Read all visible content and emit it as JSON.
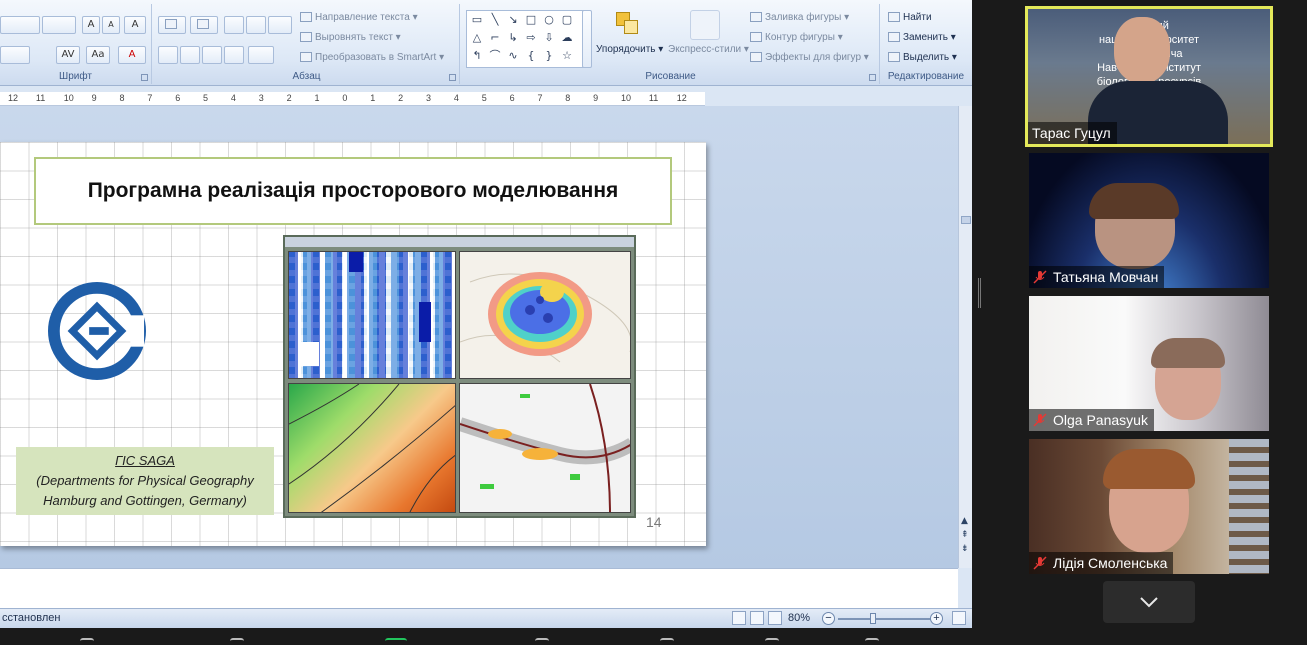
{
  "ribbon": {
    "font_group": {
      "label": "Шрифт",
      "grow_font": "A",
      "shrink_font": "A",
      "clear_format": "A",
      "spacing": "AV",
      "case": "Aa",
      "font_color": "A"
    },
    "paragraph_group": {
      "label": "Абзац",
      "text_direction": "Направление текста",
      "align_text": "Выровнять текст",
      "convert_smartart": "Преобразовать в SmartArt"
    },
    "drawing_group": {
      "label": "Рисование",
      "arrange": "Упорядочить",
      "quick_styles": "Экспресс-стили",
      "shape_fill": "Заливка фигуры",
      "shape_outline": "Контур фигуры",
      "shape_effects": "Эффекты для фигур"
    },
    "editing_group": {
      "label": "Редактирование",
      "find": "Найти",
      "replace": "Заменить",
      "select": "Выделить"
    }
  },
  "ruler": {
    "ticks": [
      "12",
      "11",
      "10",
      "9",
      "8",
      "7",
      "6",
      "5",
      "4",
      "3",
      "2",
      "1",
      "0",
      "1",
      "2",
      "3",
      "4",
      "5",
      "6",
      "7",
      "8",
      "9",
      "10",
      "11",
      "12"
    ]
  },
  "slide": {
    "title": "Програмна реалізація просторового моделювання",
    "caption_line1": "ГІС SAGA",
    "caption_line2": "(Departments for Physical Geography",
    "caption_line3": "Hamburg and Gottingen, Germany)",
    "number": "14"
  },
  "statusbar": {
    "text": "сстановлен",
    "zoom_percent": "80%",
    "zoom_minus": "−",
    "zoom_plus": "+"
  },
  "participants": [
    {
      "name": "Тарас Гуцул",
      "muted": false,
      "active": true
    },
    {
      "name": "Татьяна Мовчан",
      "muted": true,
      "active": false
    },
    {
      "name": "Olga Panasyuk",
      "muted": true,
      "active": false
    },
    {
      "name": "Лідія Смоленська",
      "muted": true,
      "active": false
    }
  ],
  "background_text": {
    "line1": "Чер                     кий",
    "line2": "національн    ерситет",
    "line3": "імені К          овича",
    "line4": "Навчально-         Інститут",
    "line5": "біології, хім       ресурсів"
  },
  "colors": {
    "active_speaker_border": "#e4e95a",
    "muted_icon": "#e53935",
    "slide_title_border": "#b3c97c",
    "caption_bg": "#d6e4bd"
  }
}
